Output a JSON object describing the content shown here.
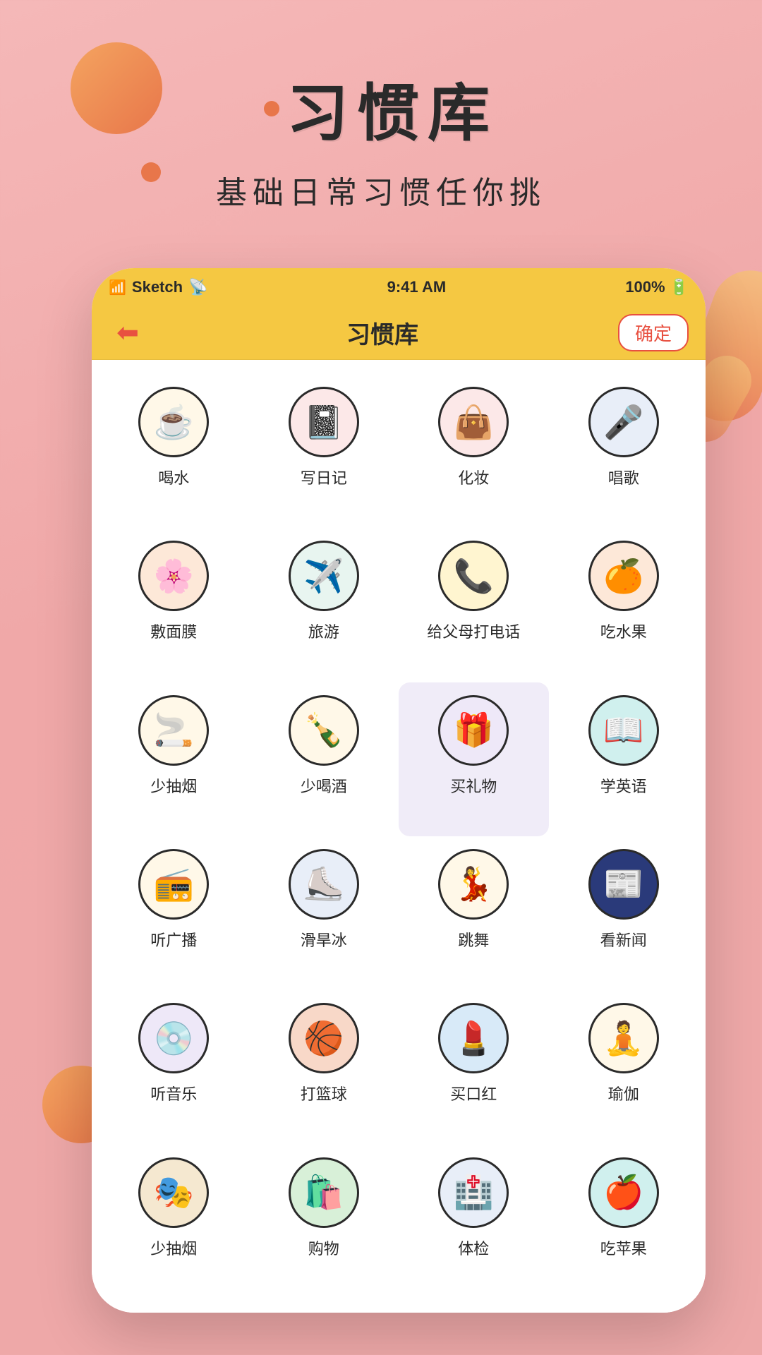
{
  "background_color": "#f0a0a0",
  "title": {
    "dot": "·",
    "main": "习惯库",
    "subtitle": "基础日常习惯任你挑"
  },
  "status_bar": {
    "carrier": "Sketch",
    "wifi_icon": "wifi",
    "time": "9:41 AM",
    "battery": "100%"
  },
  "nav": {
    "back_label": "←",
    "title": "习惯库",
    "confirm_label": "确定"
  },
  "habits": [
    {
      "id": 1,
      "label": "喝水",
      "icon": "☕",
      "bg": "bg-cream",
      "selected": false
    },
    {
      "id": 2,
      "label": "写日记",
      "icon": "📓",
      "bg": "bg-pink",
      "selected": false
    },
    {
      "id": 3,
      "label": "化妆",
      "icon": "👜",
      "bg": "bg-pink",
      "selected": false
    },
    {
      "id": 4,
      "label": "唱歌",
      "icon": "🎤",
      "bg": "bg-blue",
      "selected": false
    },
    {
      "id": 5,
      "label": "敷面膜",
      "icon": "🌸",
      "bg": "bg-peach",
      "selected": false
    },
    {
      "id": 6,
      "label": "旅游",
      "icon": "✈️",
      "bg": "bg-mint",
      "selected": false
    },
    {
      "id": 7,
      "label": "给父母打电话",
      "icon": "📞",
      "bg": "bg-yellow",
      "selected": false
    },
    {
      "id": 8,
      "label": "吃水果",
      "icon": "🍊",
      "bg": "bg-peach",
      "selected": false
    },
    {
      "id": 9,
      "label": "少抽烟",
      "icon": "🚬",
      "bg": "bg-cream",
      "selected": false
    },
    {
      "id": 10,
      "label": "少喝酒",
      "icon": "🍾",
      "bg": "bg-cream",
      "selected": false
    },
    {
      "id": 11,
      "label": "买礼物",
      "icon": "🎁",
      "bg": "bg-lavender",
      "selected": true
    },
    {
      "id": 12,
      "label": "学英语",
      "icon": "📖",
      "bg": "bg-teal",
      "selected": false
    },
    {
      "id": 13,
      "label": "听广播",
      "icon": "📻",
      "bg": "bg-cream",
      "selected": false
    },
    {
      "id": 14,
      "label": "滑旱冰",
      "icon": "⛸️",
      "bg": "bg-blue",
      "selected": false
    },
    {
      "id": 15,
      "label": "跳舞",
      "icon": "💃",
      "bg": "bg-cream",
      "selected": false
    },
    {
      "id": 16,
      "label": "看新闻",
      "icon": "📰",
      "bg": "bg-navy",
      "selected": false
    },
    {
      "id": 17,
      "label": "听音乐",
      "icon": "💿",
      "bg": "bg-lavender",
      "selected": false
    },
    {
      "id": 18,
      "label": "打篮球",
      "icon": "🏀",
      "bg": "bg-salmon",
      "selected": false
    },
    {
      "id": 19,
      "label": "买口红",
      "icon": "💄",
      "bg": "bg-light-blue",
      "selected": false
    },
    {
      "id": 20,
      "label": "瑜伽",
      "icon": "🧘",
      "bg": "bg-cream",
      "selected": false
    },
    {
      "id": 21,
      "label": "少抽烟",
      "icon": "🎭",
      "bg": "bg-tan",
      "selected": false
    },
    {
      "id": 22,
      "label": "购物",
      "icon": "🛍️",
      "bg": "bg-light-green",
      "selected": false
    },
    {
      "id": 23,
      "label": "体检",
      "icon": "🏥",
      "bg": "bg-blue",
      "selected": false
    },
    {
      "id": 24,
      "label": "吃苹果",
      "icon": "🍎",
      "bg": "bg-teal",
      "selected": false
    }
  ]
}
